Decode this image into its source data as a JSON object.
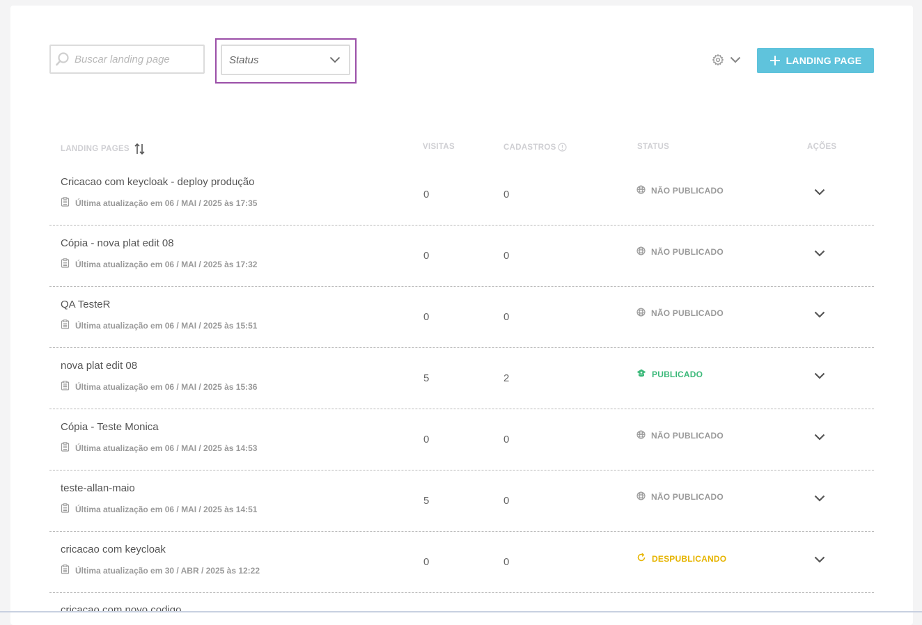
{
  "toolbar": {
    "search_placeholder": "Buscar landing page",
    "status_placeholder": "Status",
    "add_button_label": "LANDING PAGE"
  },
  "table": {
    "headers": {
      "landing_pages": "LANDING PAGES",
      "visits": "VISITAS",
      "signups": "CADASTROS",
      "status": "STATUS",
      "actions": "AÇÕES"
    },
    "rows": [
      {
        "name": "Cricacao com keycloak - deploy produção",
        "updated": "Última atualização em 06 / MAI / 2025 às 17:35",
        "visits": "0",
        "signups": "0",
        "status": "NÃO PUBLICADO",
        "status_kind": "unpublished"
      },
      {
        "name": "Cópia - nova plat edit 08",
        "updated": "Última atualização em 06 / MAI / 2025 às 17:32",
        "visits": "0",
        "signups": "0",
        "status": "NÃO PUBLICADO",
        "status_kind": "unpublished"
      },
      {
        "name": "QA TesteR",
        "updated": "Última atualização em 06 / MAI / 2025 às 15:51",
        "visits": "0",
        "signups": "0",
        "status": "NÃO PUBLICADO",
        "status_kind": "unpublished"
      },
      {
        "name": "nova plat edit 08",
        "updated": "Última atualização em 06 / MAI / 2025 às 15:36",
        "visits": "5",
        "signups": "2",
        "status": "PUBLICADO",
        "status_kind": "published"
      },
      {
        "name": "Cópia - Teste Monica",
        "updated": "Última atualização em 06 / MAI / 2025 às 14:53",
        "visits": "0",
        "signups": "0",
        "status": "NÃO PUBLICADO",
        "status_kind": "unpublished"
      },
      {
        "name": "teste-allan-maio",
        "updated": "Última atualização em 06 / MAI / 2025 às 14:51",
        "visits": "5",
        "signups": "0",
        "status": "NÃO PUBLICADO",
        "status_kind": "unpublished"
      },
      {
        "name": "cricacao com keycloak",
        "updated": "Última atualização em 30 / ABR / 2025 às 12:22",
        "visits": "0",
        "signups": "0",
        "status": "DESPUBLICANDO",
        "status_kind": "unpublishing"
      }
    ],
    "partial_row_name": "cricacao com novo codigo"
  },
  "colors": {
    "accent": "#5fc3dc",
    "highlight_border": "#9b4fa8",
    "published": "#3cb97a",
    "unpublished": "#9a9a9a",
    "unpublishing": "#e6b400"
  },
  "icons": {
    "search": "search-icon",
    "status_dropdown": "chevron-down-icon",
    "settings": "gear-icon",
    "add": "plus-icon",
    "sort": "sort-icon",
    "info": "info-icon",
    "updated": "clipboard-icon",
    "unpublished": "globe-icon",
    "published": "published-icon",
    "unpublishing": "refresh-icon",
    "row_action": "chevron-down-icon"
  }
}
